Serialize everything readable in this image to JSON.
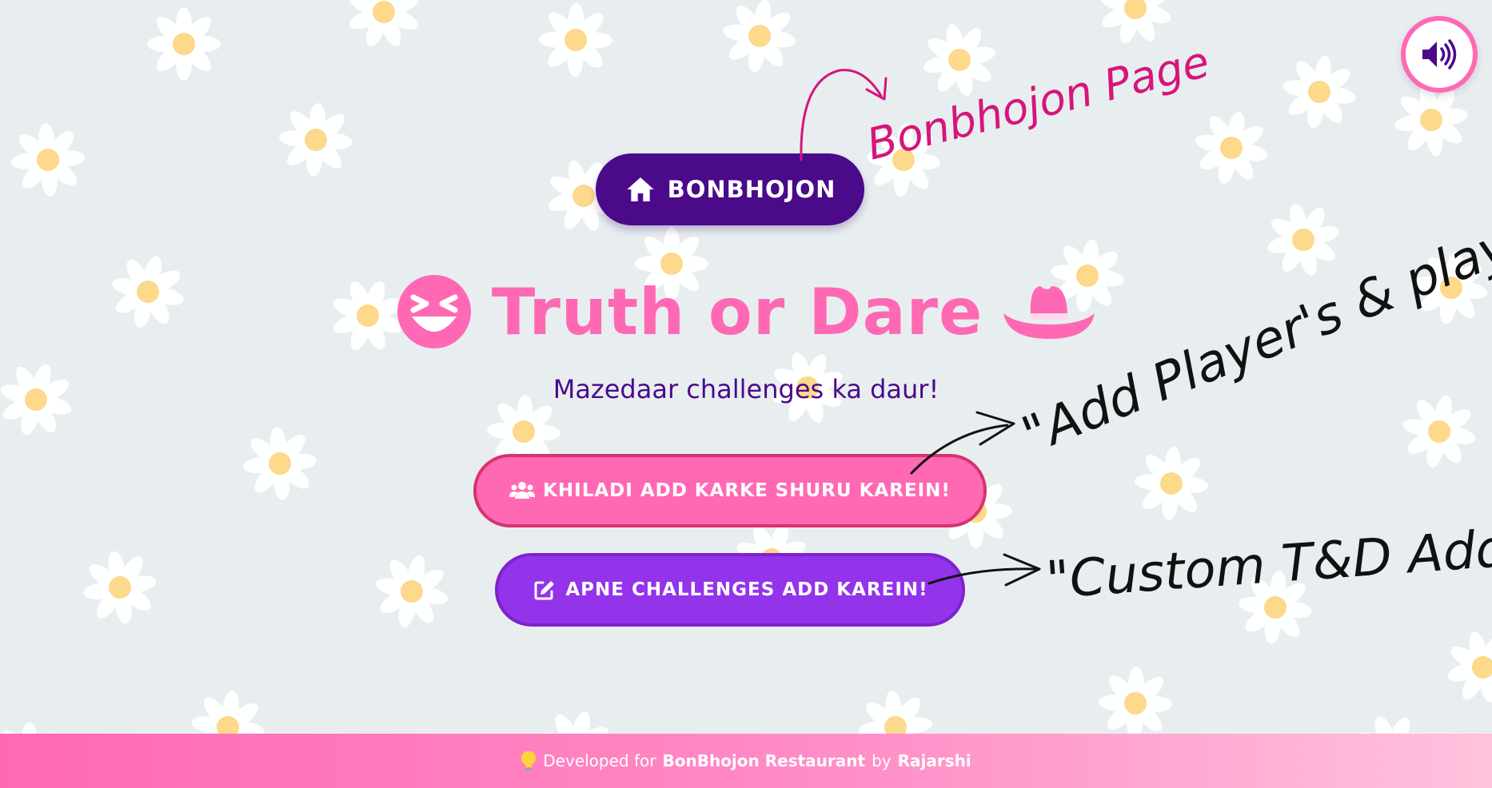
{
  "home_button": {
    "label": "BONBHOJON",
    "icon": "home-icon"
  },
  "title": {
    "text": "Truth or Dare",
    "left_icon": "laughing-face-icon",
    "right_icon": "cowboy-hat-icon",
    "color": "#ff69b4"
  },
  "subtitle": "Mazedaar challenges ka daur!",
  "buttons": {
    "add_players": {
      "label": "KHILADI ADD KARKE SHURU KAREIN!",
      "icon": "users-icon",
      "color": "#ff69b4"
    },
    "add_challenges": {
      "label": "APNE CHALLENGES ADD KAREIN!",
      "icon": "edit-icon",
      "color": "#9333ea"
    }
  },
  "sound_button": {
    "icon": "volume-icon"
  },
  "footer": {
    "icon": "lightbulb-icon",
    "prefix": "Developed for",
    "restaurant": "BonBhojon Restaurant",
    "by": "by",
    "author": "Rajarshi"
  },
  "annotations": {
    "bonbhojon_page": "Bonbhojon Page",
    "add_players": "\"Add Player's & play...\"",
    "custom": "\"Custom T&D Add\""
  },
  "colors": {
    "accent": "#ff69b4",
    "brand": "#4a0a8a",
    "purple": "#9333ea",
    "background": "#e8eef0"
  }
}
